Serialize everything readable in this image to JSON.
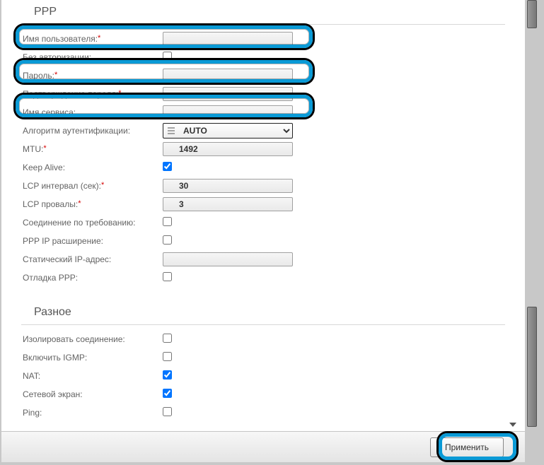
{
  "sections": {
    "ppp_title": "PPP",
    "misc_title": "Разное"
  },
  "ppp": {
    "username_label": "Имя пользователя:",
    "username_value": "",
    "noauth_label": "Без авторизации:",
    "noauth_checked": false,
    "password_label": "Пароль:",
    "password_value": "",
    "password_confirm_label": "Подтверждение пароля:",
    "password_confirm_value": "",
    "service_label": "Имя сервиса:",
    "service_value": "",
    "auth_algo_label": "Алгоритм аутентификации:",
    "auth_algo_value": "AUTO",
    "mtu_label": "MTU:",
    "mtu_value": "1492",
    "keepalive_label": "Keep Alive:",
    "keepalive_checked": true,
    "lcp_interval_label": "LCP интервал (сек):",
    "lcp_interval_value": "30",
    "lcp_fail_label": "LCP провалы:",
    "lcp_fail_value": "3",
    "dial_on_demand_label": "Соединение по требованию:",
    "dial_on_demand_checked": false,
    "ppp_ip_ext_label": "PPP IP расширение:",
    "ppp_ip_ext_checked": false,
    "static_ip_label": "Статический IP-адрес:",
    "static_ip_value": "",
    "debug_label": "Отладка PPP:",
    "debug_checked": false
  },
  "misc": {
    "isolate_label": "Изолировать соединение:",
    "isolate_checked": false,
    "igmp_label": "Включить IGMP:",
    "igmp_checked": false,
    "nat_label": "NAT:",
    "nat_checked": true,
    "firewall_label": "Сетевой экран:",
    "firewall_checked": true,
    "ping_label": "Ping:",
    "ping_checked": false
  },
  "footer": {
    "apply_label": "Применить"
  }
}
